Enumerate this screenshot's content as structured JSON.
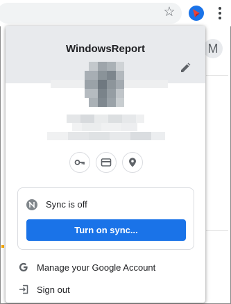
{
  "profile": {
    "name": "WindowsReport"
  },
  "sync": {
    "status": "Sync is off",
    "button_label": "Turn on sync..."
  },
  "menu": {
    "manage_account": "Manage your Google Account",
    "sign_out": "Sign out"
  },
  "background": {
    "avatar_letter": "M"
  },
  "colors": {
    "accent": "#1a73e8",
    "header_bg": "#e8eaed"
  },
  "icons": [
    "star-icon",
    "extension-icon",
    "menu-icon",
    "edit-icon",
    "key-icon",
    "card-icon",
    "location-icon",
    "sync-off-icon",
    "google-icon",
    "sign-out-icon"
  ]
}
